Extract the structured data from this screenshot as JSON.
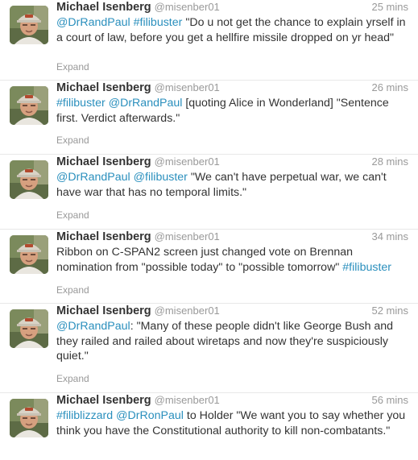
{
  "tweets": [
    {
      "fullname": "Michael Isenberg",
      "username": "@misenber01",
      "time": "25 mins",
      "parts": [
        {
          "text": "@DrRandPaul",
          "link": true
        },
        {
          "text": " "
        },
        {
          "text": "#filibuster",
          "link": true
        },
        {
          "text": " \"Do u not get the chance to explain yrself in a court of law, before you get a hellfire missile dropped on yr head\""
        }
      ],
      "expand": "Expand"
    },
    {
      "fullname": "Michael Isenberg",
      "username": "@misenber01",
      "time": "26 mins",
      "parts": [
        {
          "text": "#filibuster",
          "link": true
        },
        {
          "text": " "
        },
        {
          "text": "@DrRandPaul",
          "link": true
        },
        {
          "text": " [quoting Alice in Wonderland] \"Sentence first. Verdict afterwards.\""
        }
      ],
      "expand": "Expand"
    },
    {
      "fullname": "Michael Isenberg",
      "username": "@misenber01",
      "time": "28 mins",
      "parts": [
        {
          "text": "@DrRandPaul",
          "link": true
        },
        {
          "text": " "
        },
        {
          "text": "@filibuster",
          "link": true
        },
        {
          "text": " \"We can't have perpetual war, we can't have war that has no temporal limits.\""
        }
      ],
      "expand": "Expand"
    },
    {
      "fullname": "Michael Isenberg",
      "username": "@misenber01",
      "time": "34 mins",
      "parts": [
        {
          "text": "Ribbon on C-SPAN2 screen just changed vote on Brennan nomination from \"possible today\" to \"possible tomorrow\" "
        },
        {
          "text": "#filibuster",
          "link": true
        }
      ],
      "expand": "Expand"
    },
    {
      "fullname": "Michael Isenberg",
      "username": "@misenber01",
      "time": "52 mins",
      "parts": [
        {
          "text": "@DrRandPaul",
          "link": true
        },
        {
          "text": ": \"Many of these people didn't like George Bush and they railed and railed about wiretaps and now they're suspiciously quiet.\""
        }
      ],
      "expand": "Expand"
    },
    {
      "fullname": "Michael Isenberg",
      "username": "@misenber01",
      "time": "56 mins",
      "parts": [
        {
          "text": "#filiblizzard",
          "link": true
        },
        {
          "text": " "
        },
        {
          "text": "@DrRonPaul",
          "link": true
        },
        {
          "text": " to Holder \"We want you to say whether you think you have the Constitutional authority to kill non-combatants.\""
        }
      ],
      "expand": ""
    }
  ],
  "colors": {
    "link": "#2a8fbd",
    "meta": "#999999",
    "text": "#333333"
  },
  "icons": {
    "avatar": "avatar-photo-icon"
  }
}
